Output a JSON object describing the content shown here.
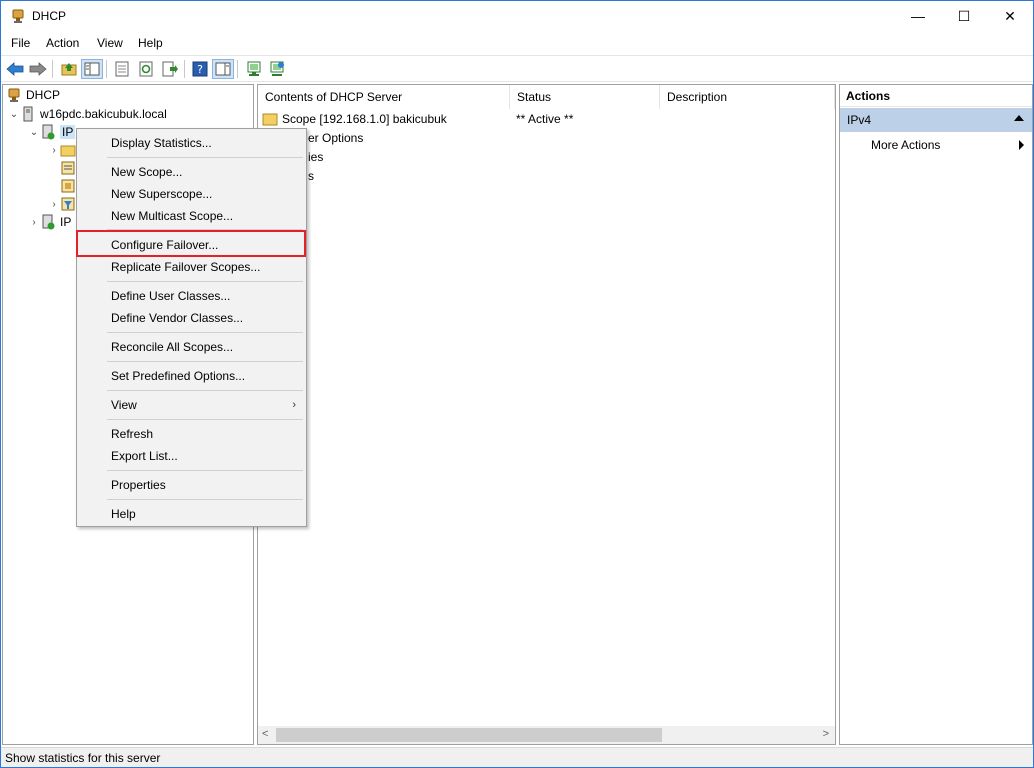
{
  "window": {
    "title": "DHCP",
    "controls": {
      "minimize": "—",
      "maximize": "☐",
      "close": "✕"
    }
  },
  "menu": [
    "File",
    "Action",
    "View",
    "Help"
  ],
  "toolbar": {
    "buttons": [
      "back-icon",
      "forward-icon",
      "up-folder-icon",
      "show-hide-tree-icon",
      "properties-icon",
      "refresh-icon",
      "export-icon",
      "help-icon",
      "action-pane-icon",
      "server-icon",
      "add-server-icon"
    ]
  },
  "tree": {
    "root": "DHCP",
    "server": "w16pdc.bakicubuk.local",
    "ipv4": "IPv4",
    "ipv4_partial": "IP",
    "ipv6_partial": "IP"
  },
  "content": {
    "columns": [
      "Contents of DHCP Server",
      "Status",
      "Description"
    ],
    "rows": [
      {
        "name": "Scope [192.168.1.0] bakicubuk",
        "status": "** Active **",
        "description": ""
      },
      {
        "name": "er Options",
        "status": "",
        "description": ""
      },
      {
        "name": "ies",
        "status": "",
        "description": ""
      },
      {
        "name": "s",
        "status": "",
        "description": ""
      }
    ]
  },
  "actions": {
    "header": "Actions",
    "group": "IPv4",
    "item": "More Actions"
  },
  "context_menu": {
    "items": [
      "Display Statistics...",
      "New Scope...",
      "New Superscope...",
      "New Multicast Scope...",
      "Configure Failover...",
      "Replicate Failover Scopes...",
      "Define User Classes...",
      "Define Vendor Classes...",
      "Reconcile All Scopes...",
      "Set Predefined Options...",
      "View",
      "Refresh",
      "Export List...",
      "Properties",
      "Help"
    ],
    "submenu_arrow": "›"
  },
  "statusbar": {
    "text": "Show statistics for this server"
  },
  "colors": {
    "highlight_box": "#e2212b",
    "actions_group_bg": "#bcd0e8",
    "window_border": "#2b79d6"
  }
}
